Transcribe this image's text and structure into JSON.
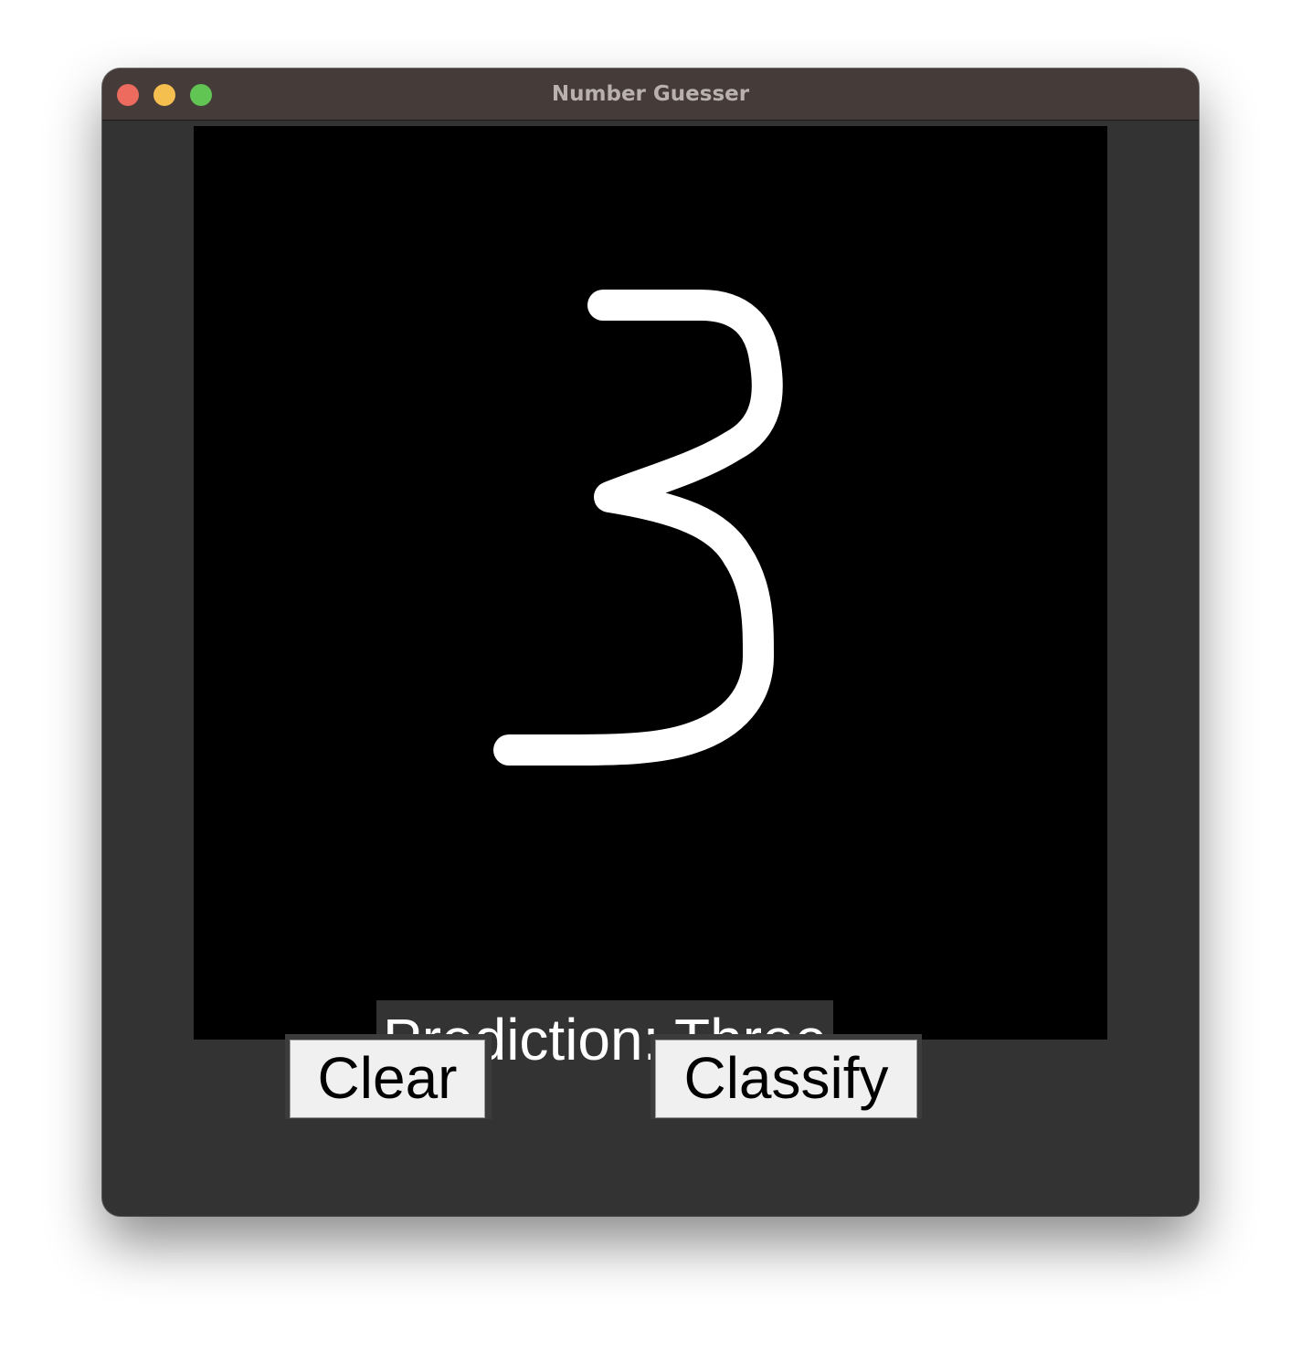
{
  "window": {
    "title": "Number Guesser"
  },
  "controls": {
    "close": "close-button",
    "minimize": "minimize-button",
    "zoom": "zoom-button"
  },
  "prediction": {
    "text": "Prediction: Three"
  },
  "buttons": {
    "clear_label": "Clear",
    "classify_label": "Classify"
  },
  "canvas": {
    "background": "#000000",
    "stroke_color": "#ffffff",
    "drawn_digit": "3"
  },
  "colors": {
    "window_bg": "#333333",
    "titlebar_bg": "#453b38",
    "title_text": "#b8b1ae",
    "close": "#ec6a5e",
    "minimize": "#f4bf4f",
    "zoom": "#61c554"
  }
}
